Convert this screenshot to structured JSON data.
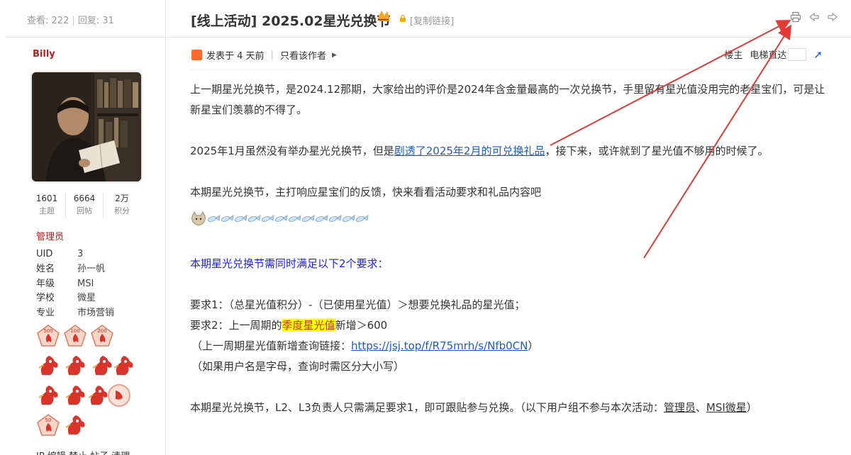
{
  "topbar": {
    "views_label": "查看:",
    "views": "222",
    "replies_label": "回复:",
    "replies": "31",
    "title": "[线上活动] 2025.02星光兑换节",
    "copy_link": "[复制链接]"
  },
  "user": {
    "name": "Billy",
    "counts": [
      {
        "num": "1601",
        "label": "主题"
      },
      {
        "num": "6664",
        "label": "回帖"
      },
      {
        "num": "2万",
        "label": "积分"
      }
    ],
    "role": "管理员",
    "fields": [
      {
        "k": "UID",
        "v": "3"
      },
      {
        "k": "姓名",
        "v": "孙一帆"
      },
      {
        "k": "年级",
        "v": "MSI"
      },
      {
        "k": "学校",
        "v": "微星"
      },
      {
        "k": "专业",
        "v": "市场营销"
      }
    ],
    "medal_numbers": [
      "500",
      "100",
      "200",
      "50"
    ],
    "admin_links": "IP 编辑 禁止 帖子 清理"
  },
  "post": {
    "posted": "发表于 4 天前",
    "only_author": "只看该作者",
    "floor": "楼主",
    "elevator": "电梯直达",
    "p1": "上一期星光兑换节，是2024.12那期，大家给出的评价是2024年含金量最高的一次兑换节，手里留有星光值没用完的老星宝们，可是让新星宝们羡慕的不得了。",
    "p2_pre": "2025年1月虽然没有举办星光兑换节，但是",
    "p2_link": "剧透了2025年2月的可兑换礼品",
    "p2_post": "，接下来，或许就到了星光值不够用的时候了。",
    "p3": "本期星光兑换节，主打响应星宝们的反馈，快来看看活动要求和礼品内容吧",
    "p4": "本期星光兑换节需同时满足以下2个要求：",
    "req1": "要求1：（总星光值积分）-（已使用星光值）＞想要兑换礼品的星光值；",
    "req2_pre": "要求2：上一周期的",
    "req2_hl": "季度星光值",
    "req2_post": "新增＞600",
    "query_pre": "（上一周期星光值新增查询链接：",
    "query_link": "https://jsj.top/f/R75mrh/s/Nfb0CN",
    "query_post": "）",
    "case_note": "（如果用户名是字母，查询时需区分大小写）",
    "p5_pre": "本期星光兑换节，L2、L3负责人只需满足要求1，即可跟贴参与兑换。（以下用户组不参与本次活动：",
    "p5_link1": "管理员",
    "p5_sep": "、",
    "p5_link2": "MSI微星",
    "p5_post": "）"
  },
  "colors": {
    "username": "#b22222",
    "link": "#1e5bc6",
    "blue_text": "#1a1aff",
    "highlight": "#ffff00",
    "annotation_arrow": "#e53935"
  }
}
